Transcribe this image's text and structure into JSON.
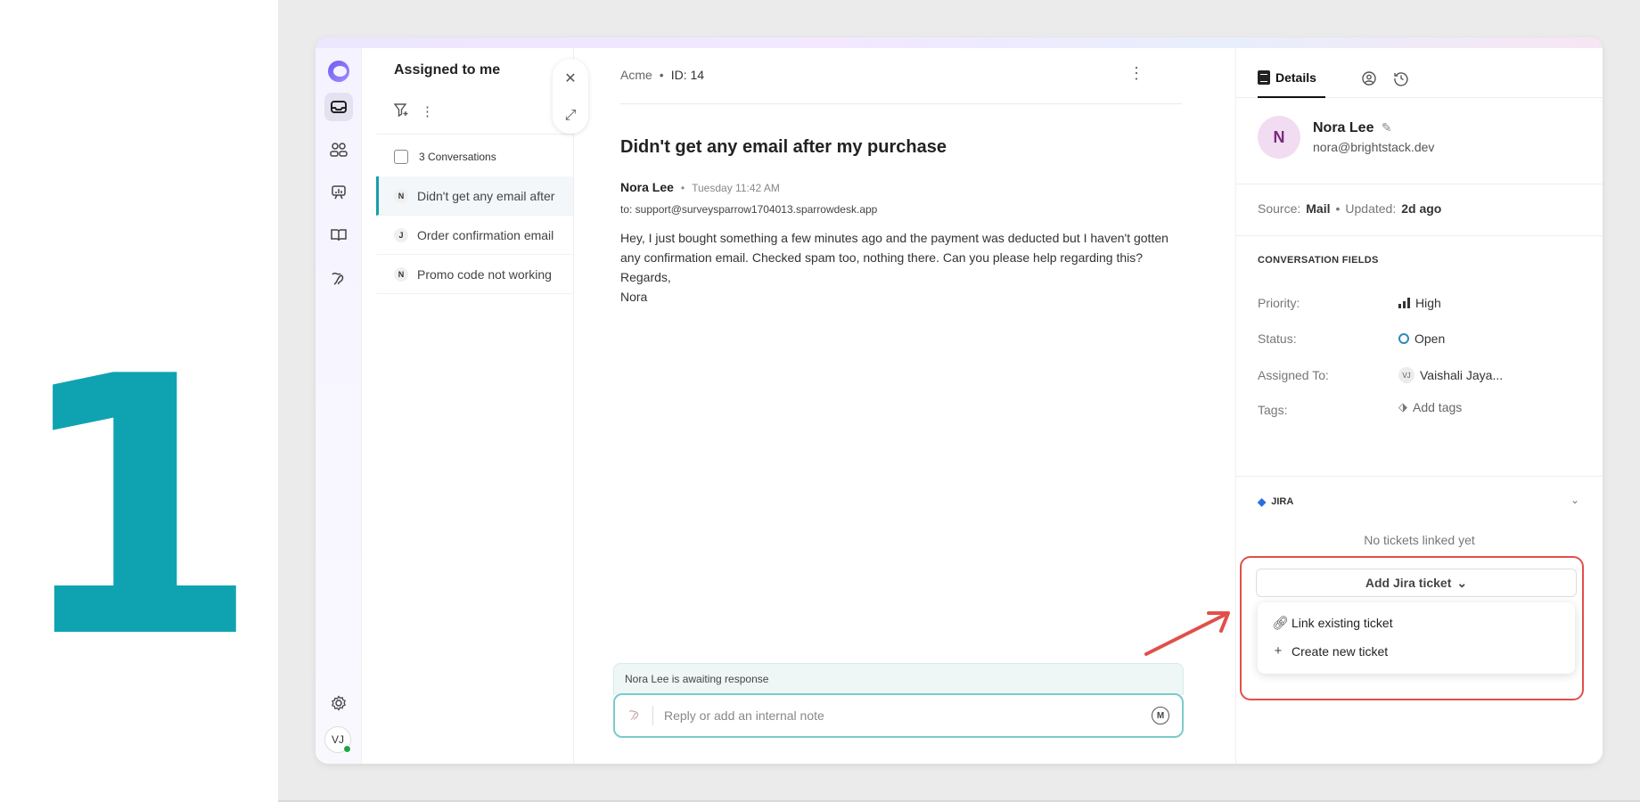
{
  "step": {
    "number": "1",
    "color": "#0fa3b1"
  },
  "rail": {
    "icons": [
      "logo-icon",
      "inbox-icon",
      "contacts-icon",
      "reports-icon",
      "knowledge-base-icon",
      "automation-icon",
      "settings-icon"
    ],
    "avatar_initials": "VJ",
    "online_color": "#22a54a"
  },
  "list": {
    "title": "Assigned to me",
    "count_label": "3 Conversations",
    "conversations": [
      {
        "badge": "N",
        "title": "Didn't get any email after"
      },
      {
        "badge": "J",
        "title": "Order confirmation email"
      },
      {
        "badge": "N",
        "title": "Promo code not working"
      }
    ]
  },
  "conversation": {
    "org": "Acme",
    "id_label": "ID: 14",
    "subject": "Didn't get any email after my purchase",
    "sender": "Nora Lee",
    "time": "Tuesday 11:42 AM",
    "to": "to: support@surveysparrow1704013.sparrowdesk.app",
    "body": [
      "Hey, I just bought something a few minutes ago and the payment was deducted but I haven't gotten any confirmation email. Checked spam too, nothing there. Can you please help regarding this?",
      "Regards,",
      "Nora"
    ],
    "awaiting": "Nora Lee is awaiting response",
    "reply_placeholder": "Reply or add an internal note"
  },
  "details": {
    "tab_details": "Details",
    "contact": {
      "initial": "N",
      "name": "Nora Lee",
      "email": "nora@brightstack.dev"
    },
    "source_label": "Source:",
    "source_value": "Mail",
    "updated_label": "Updated:",
    "updated_value": "2d ago",
    "fields_title": "CONVERSATION FIELDS",
    "fields": {
      "priority_label": "Priority:",
      "priority_value": "High",
      "status_label": "Status:",
      "status_value": "Open",
      "assigned_label": "Assigned To:",
      "assigned_badge": "VJ",
      "assigned_value": "Vaishali Jaya...",
      "tags_label": "Tags:",
      "tags_value": "Add tags"
    },
    "jira": {
      "title": "JIRA",
      "empty": "No tickets linked yet",
      "add_button": "Add Jira ticket",
      "menu": [
        "Link existing ticket",
        "Create new ticket"
      ]
    }
  },
  "colors": {
    "accent_teal": "#14a0a8",
    "highlight_red": "#e0504a",
    "jira_blue": "#2a6fe0"
  }
}
